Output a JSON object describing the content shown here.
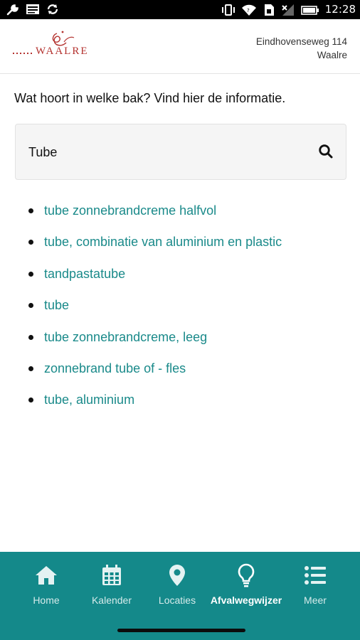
{
  "status_bar": {
    "time": "12:28",
    "left_icons": [
      "wrench-icon",
      "image-icon",
      "sync-icon"
    ],
    "right_icons": [
      "vibrate-icon",
      "wifi-icon",
      "sim-icon",
      "no-signal-icon",
      "battery-icon"
    ]
  },
  "header": {
    "logo_text": "WAALRE",
    "address_line1": "Eindhovenseweg 114",
    "address_line2": "Waalre"
  },
  "main": {
    "intro": "Wat hoort in welke bak? Vind hier de informatie.",
    "search": {
      "value": "Tube",
      "button_icon": "search-icon"
    },
    "results": [
      {
        "label": "tube zonnebrandcreme halfvol"
      },
      {
        "label": "tube, combinatie van aluminium en plastic"
      },
      {
        "label": "tandpastatube"
      },
      {
        "label": "tube"
      },
      {
        "label": "tube zonnebrandcreme, leeg"
      },
      {
        "label": "zonnebrand tube of - fles"
      },
      {
        "label": "tube, aluminium"
      }
    ]
  },
  "bottom_nav": {
    "items": [
      {
        "label": "Home",
        "icon": "home-icon"
      },
      {
        "label": "Kalender",
        "icon": "calendar-icon"
      },
      {
        "label": "Locaties",
        "icon": "location-pin-icon"
      },
      {
        "label": "Afvalwegwijzer",
        "icon": "lightbulb-icon",
        "active": true
      },
      {
        "label": "Meer",
        "icon": "list-icon"
      }
    ]
  },
  "colors": {
    "accent": "#14898a",
    "link": "#1a8a8a",
    "logo": "#b4322f"
  }
}
